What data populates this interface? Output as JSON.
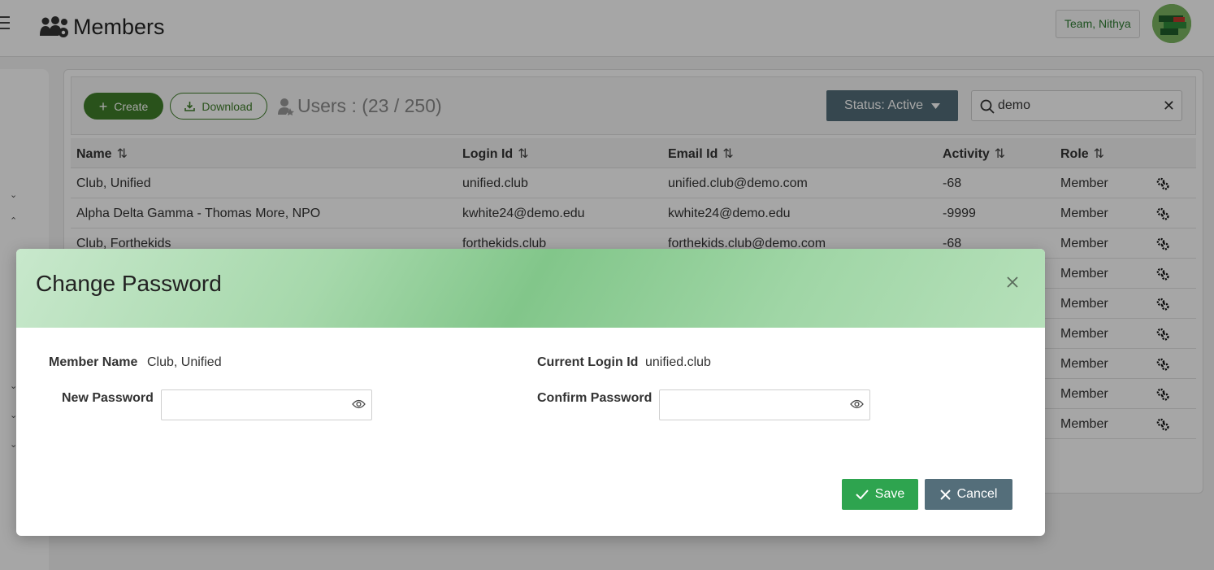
{
  "header": {
    "page_title": "Members",
    "team_label": "Team, Nithya"
  },
  "toolbar": {
    "create_label": "Create",
    "download_label": "Download",
    "users_count": "Users : (23 / 250)",
    "status_label": "Status: Active",
    "search_value": "demo"
  },
  "table": {
    "headers": [
      "Name",
      "Login Id",
      "Email Id",
      "Activity",
      "Role"
    ],
    "rows": [
      {
        "name": "Club, Unified",
        "login": "unified.club",
        "email": "unified.club@demo.com",
        "activity": "-68",
        "role": "Member"
      },
      {
        "name": "Alpha Delta Gamma - Thomas More, NPO",
        "login": "kwhite24@demo.edu",
        "email": "kwhite24@demo.edu",
        "activity": "-9999",
        "role": "Member"
      },
      {
        "name": "Club, Forthekids",
        "login": "forthekids.club",
        "email": "forthekids.club@demo.com",
        "activity": "-68",
        "role": "Member"
      },
      {
        "name": "",
        "login": "",
        "email": "",
        "activity": "",
        "role": "Member"
      },
      {
        "name": "",
        "login": "",
        "email": "",
        "activity": "",
        "role": "Member"
      },
      {
        "name": "",
        "login": "",
        "email": "",
        "activity": "",
        "role": "Member"
      },
      {
        "name": "",
        "login": "",
        "email": "",
        "activity": "",
        "role": "Member"
      },
      {
        "name": "",
        "login": "",
        "email": "",
        "activity": "",
        "role": "Member"
      },
      {
        "name": "",
        "login": "",
        "email": "",
        "activity": "",
        "role": "Member"
      }
    ]
  },
  "modal": {
    "title": "Change Password",
    "member_name_label": "Member Name",
    "member_name_value": "Club, Unified",
    "current_login_label": "Current Login Id",
    "current_login_value": "unified.club",
    "new_password_label": "New Password",
    "confirm_password_label": "Confirm Password",
    "new_password_value": "",
    "confirm_password_value": "",
    "save_label": "Save",
    "cancel_label": "Cancel"
  },
  "colors": {
    "brand_green": "#3f7f2a",
    "save_green": "#2ea44f",
    "slate": "#546e7a"
  }
}
